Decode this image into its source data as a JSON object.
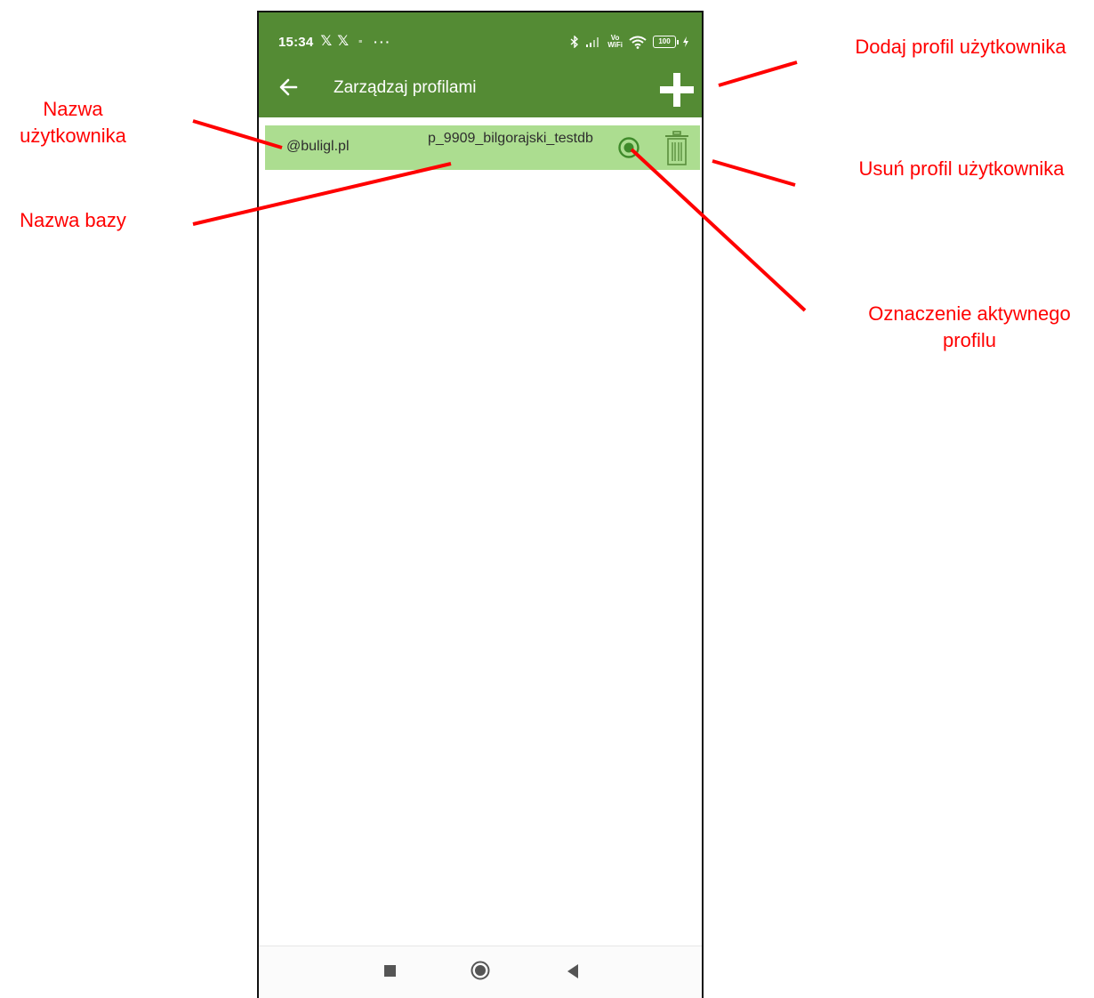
{
  "status_bar": {
    "time": "15:34",
    "left_icons": [
      "x-logo-icon",
      "x-logo-icon",
      "sim-small-icon"
    ],
    "more": "···",
    "right_icons": [
      "bluetooth-icon",
      "signal-icon",
      "vowifi-icon",
      "wifi-icon"
    ],
    "vowifi_top": "Vo",
    "vowifi_bottom": "WiFi",
    "battery": "100"
  },
  "toolbar": {
    "title": "Zarządzaj profilami",
    "back_icon": "arrow-left-icon",
    "add_icon": "plus-icon"
  },
  "profiles": [
    {
      "user": "@buligl.pl",
      "database": "p_9909_bilgorajski_testdb",
      "active": true
    }
  ],
  "annotations": {
    "user_name": "Nazwa użytkownika",
    "user_name_line1": "Nazwa",
    "user_name_line2": "użytkownika",
    "db_name": "Nazwa bazy",
    "add_profile": "Dodaj profil użytkownika",
    "delete_profile": "Usuń profil użytkownika",
    "active_line1": "Oznaczenie aktywnego",
    "active_line2": "profilu",
    "color": "#ff0000"
  },
  "colors": {
    "app_bar": "#548b34",
    "row_background": "#acdd90",
    "active_radio": "#3f8a2a"
  },
  "nav_bar": [
    "recents-square-icon",
    "home-circle-icon",
    "back-triangle-icon"
  ]
}
